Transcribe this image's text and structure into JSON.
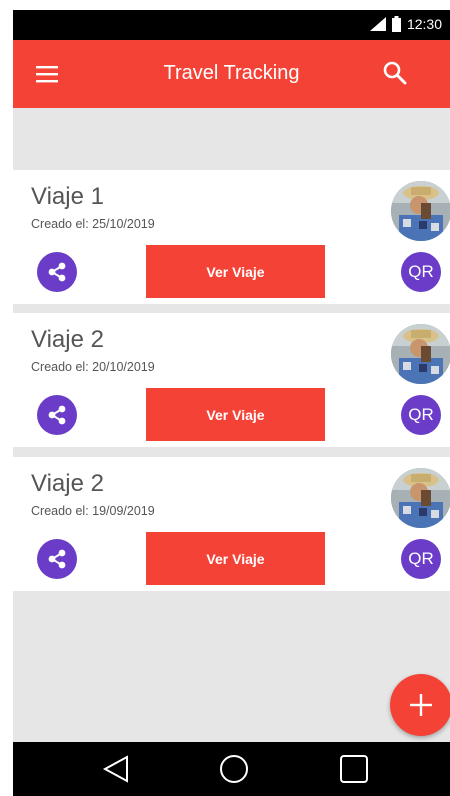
{
  "status_bar": {
    "time": "12:30",
    "icons": [
      "signal-icon",
      "battery-icon"
    ]
  },
  "app_bar": {
    "title": "Travel Tracking",
    "menu_icon": "menu-icon",
    "search_icon": "search-icon"
  },
  "trips": [
    {
      "title": "Viaje 1",
      "created": "Creado el: 25/10/2019",
      "view_label": "Ver Viaje",
      "qr_label": "QR"
    },
    {
      "title": "Viaje 2",
      "created": "Creado el: 20/10/2019",
      "view_label": "Ver Viaje",
      "qr_label": "QR"
    },
    {
      "title": "Viaje 2",
      "created": "Creado el: 19/09/2019",
      "view_label": "Ver Viaje",
      "qr_label": "QR"
    }
  ],
  "fab": {
    "icon": "plus-icon"
  },
  "nav_bar": {
    "icons": [
      "back-icon",
      "home-icon",
      "recents-icon"
    ]
  },
  "colors": {
    "primary": "#f44336",
    "accent": "#6a3cc7",
    "background": "#e6e6e6"
  }
}
